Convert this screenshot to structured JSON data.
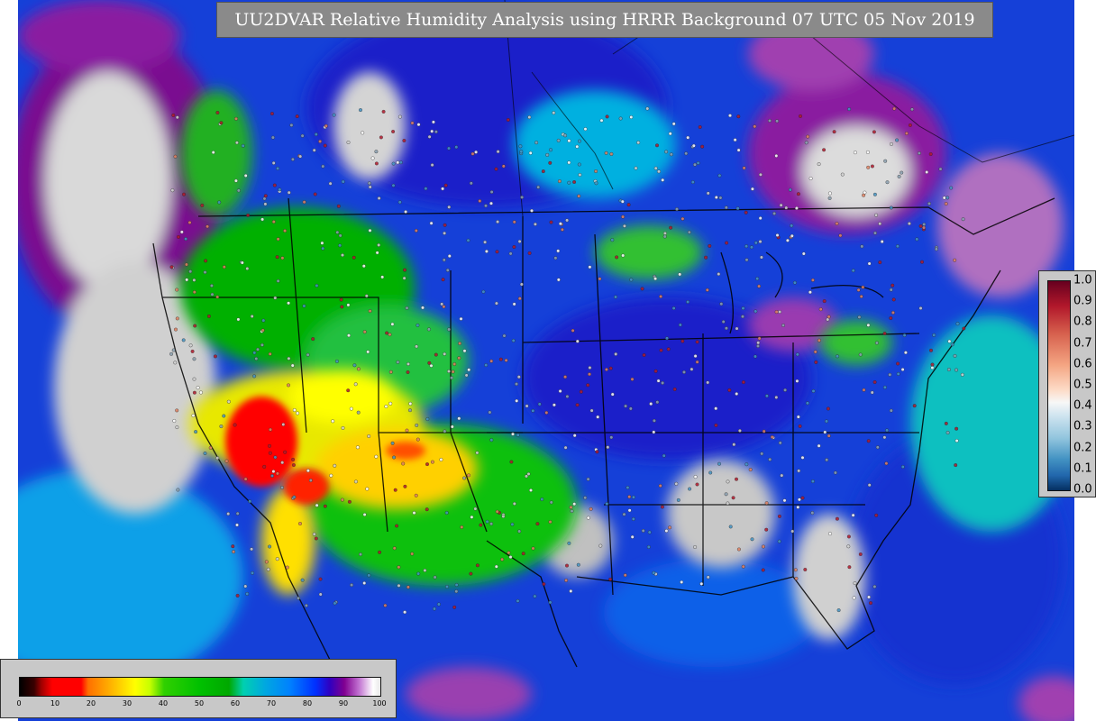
{
  "title": "UU2DVAR Relative Humidity Analysis using HRRR Background 07 UTC 05 Nov 2019",
  "rh_colorbar": {
    "ticks": [
      "0",
      "10",
      "20",
      "30",
      "40",
      "50",
      "60",
      "70",
      "80",
      "90",
      "100"
    ],
    "range": [
      0,
      100
    ]
  },
  "obs_colorbar": {
    "ticks": [
      "1.0",
      "0.9",
      "0.8",
      "0.7",
      "0.6",
      "0.5",
      "0.4",
      "0.3",
      "0.2",
      "0.1",
      "0.0"
    ],
    "range": [
      0.0,
      1.0
    ]
  },
  "colors": {
    "ocean_moist": "#1540d8",
    "dry_red": "#ff0000",
    "mid_yellow": "#ffff00",
    "moist_green": "#00c000",
    "saturated_purple": "#800090",
    "saturated_white": "#e0e0e0"
  }
}
